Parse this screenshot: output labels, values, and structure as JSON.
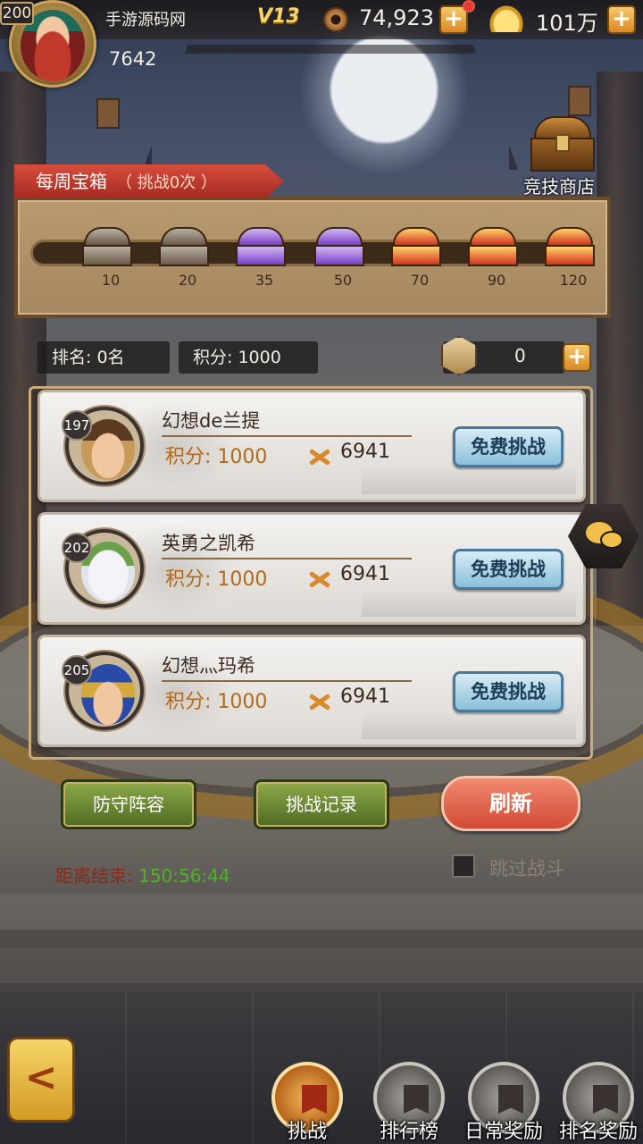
{
  "player": {
    "level": "200",
    "name": "手游源码网",
    "power": "7642",
    "vip": "V13",
    "coins": "74,923",
    "ingots": "101万"
  },
  "shop": {
    "label": "竞技商店"
  },
  "weekly": {
    "title": "每周宝箱",
    "subtitle": "（ 挑战0次 ）",
    "chests": [
      {
        "threshold": "10",
        "kind": "iron"
      },
      {
        "threshold": "20",
        "kind": "iron"
      },
      {
        "threshold": "35",
        "kind": "purple"
      },
      {
        "threshold": "50",
        "kind": "purple"
      },
      {
        "threshold": "70",
        "kind": "gold"
      },
      {
        "threshold": "90",
        "kind": "gold"
      },
      {
        "threshold": "120",
        "kind": "gold"
      }
    ]
  },
  "stats": {
    "rank": "排名: 0名",
    "points": "积分:  1000",
    "tokens": "0"
  },
  "opponents": [
    {
      "level": "197",
      "name": "幻想de兰提",
      "score": "积分: 1000",
      "power": "6941",
      "button": "免费挑战"
    },
    {
      "level": "202",
      "name": "英勇之凯希",
      "score": "积分: 1000",
      "power": "6941",
      "button": "免费挑战"
    },
    {
      "level": "205",
      "name": "幻想灬玛希",
      "score": "积分: 1000",
      "power": "6941",
      "button": "免费挑战"
    }
  ],
  "actions": {
    "defense": "防守阵容",
    "records": "挑战记录",
    "refresh": "刷新"
  },
  "countdown": {
    "label": "距离结束: ",
    "time": "150:56:44"
  },
  "skip": {
    "label": "跳过战斗"
  },
  "back": {
    "glyph": "<"
  },
  "nav": [
    {
      "label": "挑战",
      "active": true
    },
    {
      "label": "排行榜",
      "active": false
    },
    {
      "label": "日常奖励",
      "active": false
    },
    {
      "label": "排名奖励",
      "active": false
    }
  ],
  "colors": {
    "weekly_tab": "#d74d3c",
    "challenge_button": "#8ac0da",
    "refresh_button": "#e06a50",
    "green_button": "#6e8a36",
    "countdown_time": "#4eb22a",
    "score_text": "#b06a1a"
  },
  "icons": {
    "coin": "copper-coin-icon",
    "ingot": "gold-ingot-icon",
    "shop": "treasure-chest-icon",
    "token": "arena-token-icon",
    "power": "crossed-swords-icon",
    "chat": "chat-bubbles-icon",
    "nav": "star-banner-icon"
  }
}
